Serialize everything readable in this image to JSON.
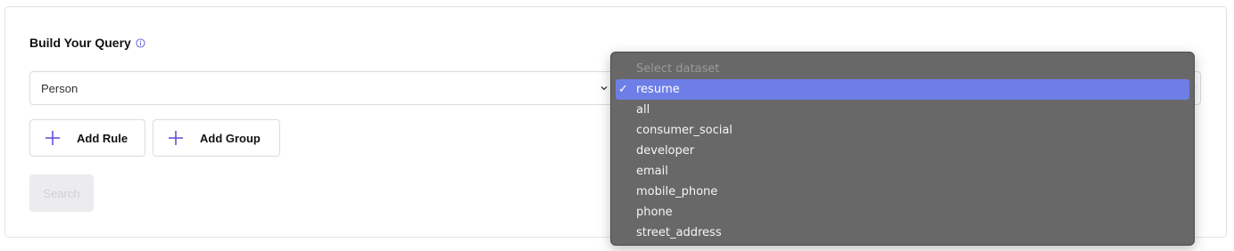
{
  "query": {
    "title": "Build Your Query",
    "entity_select": {
      "value": "Person"
    },
    "add_rule_label": "Add Rule",
    "add_group_label": "Add Group",
    "search_label": "Search"
  },
  "dataset_dropdown": {
    "placeholder": "Select dataset",
    "selected": "resume",
    "check_glyph": "✓",
    "options": [
      "resume",
      "all",
      "consumer_social",
      "developer",
      "email",
      "mobile_phone",
      "phone",
      "street_address"
    ]
  },
  "colors": {
    "accent": "#6d7fe6",
    "plus_icon": "#6b4fd6",
    "dropdown_bg": "#686868"
  }
}
